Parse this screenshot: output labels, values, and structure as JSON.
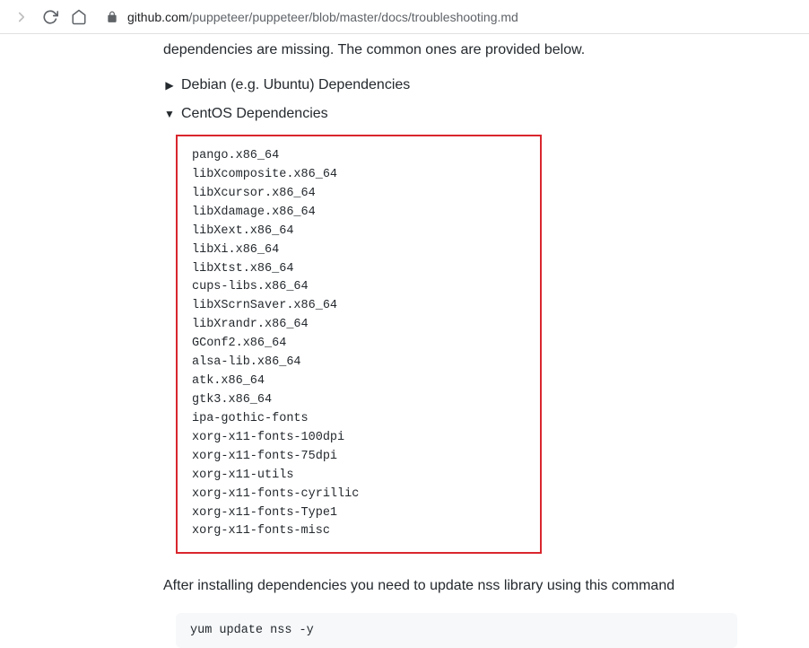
{
  "url": {
    "domain": "github.com",
    "path": "/puppeteer/puppeteer/blob/master/docs/troubleshooting.md"
  },
  "content": {
    "intro": "dependencies are missing. The common ones are provided below.",
    "debian_section": "Debian (e.g. Ubuntu) Dependencies",
    "centos_section": "CentOS Dependencies",
    "centos_deps": [
      "pango.x86_64",
      "libXcomposite.x86_64",
      "libXcursor.x86_64",
      "libXdamage.x86_64",
      "libXext.x86_64",
      "libXi.x86_64",
      "libXtst.x86_64",
      "cups-libs.x86_64",
      "libXScrnSaver.x86_64",
      "libXrandr.x86_64",
      "GConf2.x86_64",
      "alsa-lib.x86_64",
      "atk.x86_64",
      "gtk3.x86_64",
      "ipa-gothic-fonts",
      "xorg-x11-fonts-100dpi",
      "xorg-x11-fonts-75dpi",
      "xorg-x11-utils",
      "xorg-x11-fonts-cyrillic",
      "xorg-x11-fonts-Type1",
      "xorg-x11-fonts-misc"
    ],
    "after_text": "After installing dependencies you need to update nss library using this command",
    "update_cmd": "yum update nss -y"
  }
}
